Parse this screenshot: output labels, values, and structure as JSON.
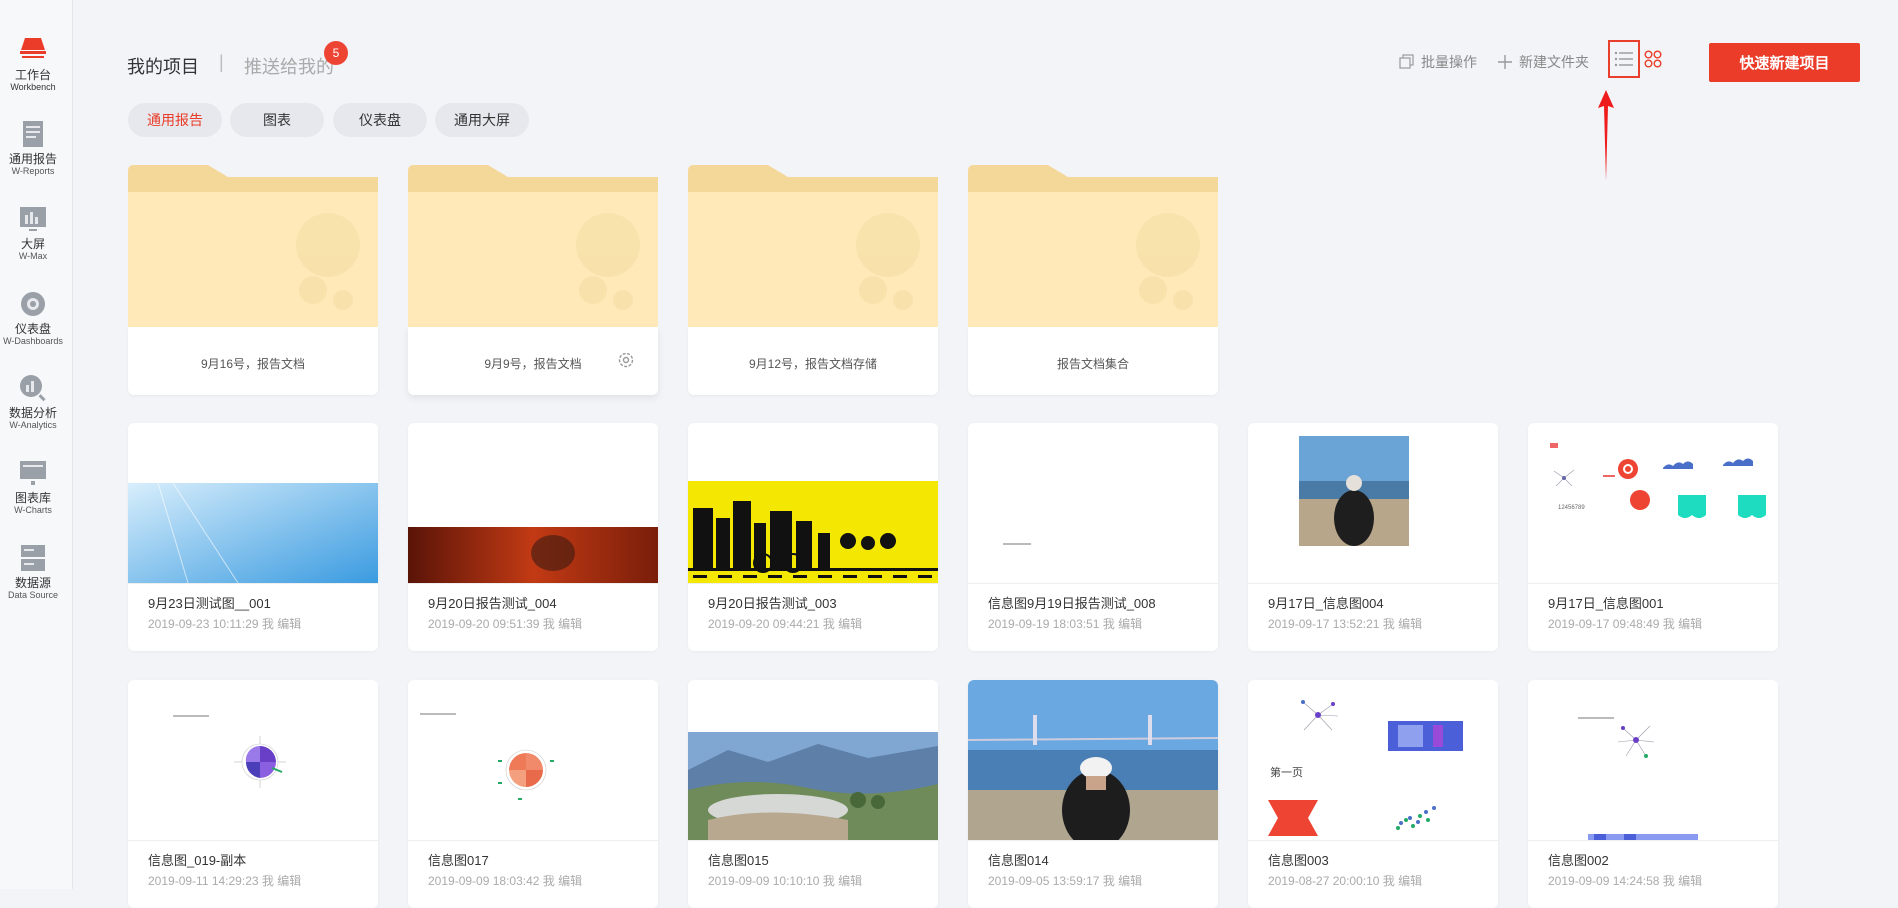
{
  "sidebar": {
    "items": [
      {
        "zh": "工作台",
        "en": "Workbench",
        "icon": "workbench-icon"
      },
      {
        "zh": "通用报告",
        "en": "W-Reports",
        "icon": "report-icon"
      },
      {
        "zh": "大屏",
        "en": "W-Max",
        "icon": "big-screen-icon"
      },
      {
        "zh": "仪表盘",
        "en": "W-Dashboards",
        "icon": "dashboard-icon"
      },
      {
        "zh": "数据分析",
        "en": "W-Analytics",
        "icon": "analytics-icon"
      },
      {
        "zh": "图表库",
        "en": "W-Charts",
        "icon": "charts-icon"
      },
      {
        "zh": "数据源",
        "en": "Data Source",
        "icon": "datasource-icon"
      }
    ]
  },
  "header": {
    "tab_mine": "我的项目",
    "separator": "|",
    "tab_pushed": "推送给我的",
    "badge_count": "5",
    "batch_label": "批量操作",
    "new_folder_label": "新建文件夹",
    "quick_new_label": "快速新建项目"
  },
  "filters": [
    "通用报告",
    "图表",
    "仪表盘",
    "通用大屏"
  ],
  "folders": [
    {
      "label": "9月16号，报告文档"
    },
    {
      "label": "9月9号，报告文档"
    },
    {
      "label": "9月12号，报告文档存储"
    },
    {
      "label": "报告文档集合"
    }
  ],
  "cards": [
    {
      "title": "9月23日测试图__001",
      "meta": "2019-09-23 10:11:29 我 编辑",
      "thumb": "sky"
    },
    {
      "title": "9月20日报告测试_004",
      "meta": "2019-09-20 09:51:39 我 编辑",
      "thumb": "fire"
    },
    {
      "title": "9月20日报告测试_003",
      "meta": "2019-09-20 09:44:21 我 编辑",
      "thumb": "city"
    },
    {
      "title": "信息图9月19日报告测试_008",
      "meta": "2019-09-19 18:03:51 我 编辑",
      "thumb": "blank"
    },
    {
      "title": "9月17日_信息图004",
      "meta": "2019-09-17 13:52:21 我 编辑",
      "thumb": "photo-small"
    },
    {
      "title": "9月17日_信息图001",
      "meta": "2019-09-17 09:48:49 我 编辑",
      "thumb": "infographic"
    },
    {
      "title": "信息图_019-副本",
      "meta": "2019-09-11 14:29:23 我 编辑",
      "thumb": "radar-purple"
    },
    {
      "title": "信息图017",
      "meta": "2019-09-09 18:03:42 我 编辑",
      "thumb": "radar-orange"
    },
    {
      "title": "信息图015",
      "meta": "2019-09-09 10:10:10 我 编辑",
      "thumb": "landscape"
    },
    {
      "title": "信息图014",
      "meta": "2019-09-05 13:59:17 我 编辑",
      "thumb": "bridge-photo"
    },
    {
      "title": "信息图003",
      "meta": "2019-08-27 20:00:10 我 编辑",
      "thumb": "infographic-2"
    },
    {
      "title": "信息图002",
      "meta": "2019-09-09 14:24:58 我 编辑",
      "thumb": "network"
    }
  ],
  "thumb_text": {
    "page_one": "第一页",
    "number": "12456789"
  },
  "colors": {
    "accent": "#ea3c28",
    "folder": "#ffe9b8",
    "folder_tab": "#f3d89a",
    "background": "#f2f4f8"
  }
}
